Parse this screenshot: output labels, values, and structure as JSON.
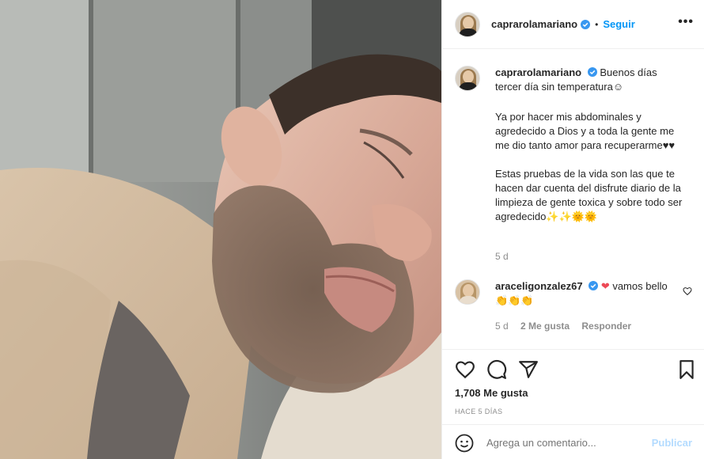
{
  "post": {
    "author": "caprarolamariano",
    "follow_label": "Seguir",
    "dot": "•",
    "more": "•••"
  },
  "caption": {
    "author": "caprarolamariano",
    "line1": "Buenos días tercer día sin temperatura☺",
    "para2": "Ya por hacer mis abdominales y agredecido a Dios y a toda la gente me me dio tanto amor para recuperarme♥♥",
    "para3": "Estas pruebas de la vida son las que te hacen dar cuenta del disfrute diario de la limpieza de gente toxica y sobre todo ser agredecido✨✨🌞🌞",
    "time": "5 d"
  },
  "comment": {
    "author": "araceligonzalez67",
    "heart": "❤",
    "text": " vamos bello 👏👏👏",
    "time": "5 d",
    "likes": "2 Me gusta",
    "reply": "Responder"
  },
  "stats": {
    "likes": "1,708 Me gusta",
    "ago": "HACE 5 DÍAS"
  },
  "add_comment": {
    "placeholder": "Agrega un comentario...",
    "publish": "Publicar"
  },
  "colors": {
    "accent": "#0095f6",
    "verified": "#3897f0",
    "publish_disabled": "#b3dbff",
    "muted": "#8e8e8e",
    "heart": "#ed4956"
  },
  "icons": {
    "like": "heart-outline-icon",
    "comment": "comment-bubble-icon",
    "share": "paper-plane-icon",
    "save": "bookmark-icon",
    "emoji": "smiley-icon",
    "verified": "verified-badge-icon"
  }
}
